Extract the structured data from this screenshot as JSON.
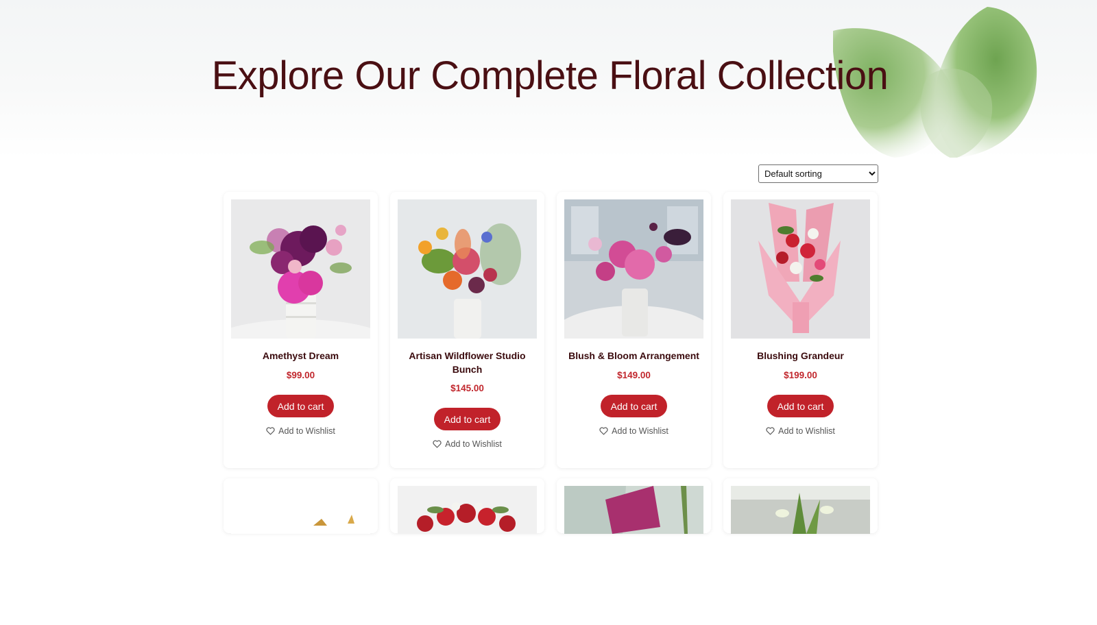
{
  "page": {
    "title": "Explore Our Complete Floral Collection"
  },
  "sorting": {
    "options": [
      "Default sorting"
    ],
    "selected": "Default sorting"
  },
  "products": [
    {
      "name": "Amethyst Dream",
      "price": "$99.00",
      "cart_label": "Add to cart",
      "wishlist_label": "Add to Wishlist"
    },
    {
      "name": "Artisan Wildflower Studio Bunch",
      "price": "$145.00",
      "cart_label": "Add to cart",
      "wishlist_label": "Add to Wishlist"
    },
    {
      "name": "Blush & Bloom Arrangement",
      "price": "$149.00",
      "cart_label": "Add to cart",
      "wishlist_label": "Add to Wishlist"
    },
    {
      "name": "Blushing Grandeur",
      "price": "$199.00",
      "cart_label": "Add to cart",
      "wishlist_label": "Add to Wishlist"
    }
  ],
  "colors": {
    "title": "#4a0f13",
    "price": "#c1272d",
    "button": "#c1222a",
    "product_name": "#3a0a0d"
  },
  "icons": {
    "wishlist": "heart-outline-icon"
  }
}
